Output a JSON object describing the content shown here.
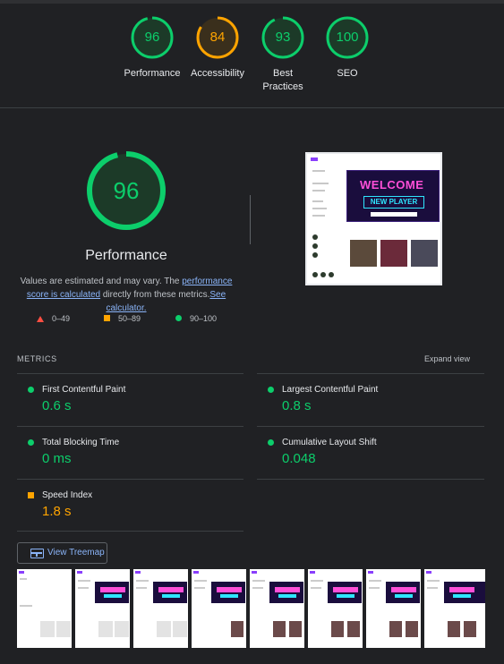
{
  "summary": {
    "gauges": [
      {
        "score": "96",
        "label": "Performance",
        "color": "#0cce6b",
        "fraction": 0.96
      },
      {
        "score": "84",
        "label": "Accessibility",
        "color": "#ffa400",
        "fraction": 0.84
      },
      {
        "score": "93",
        "label": "Best Practices",
        "color": "#0cce6b",
        "fraction": 0.93
      },
      {
        "score": "100",
        "label": "SEO",
        "color": "#0cce6b",
        "fraction": 1.0
      }
    ]
  },
  "performance": {
    "score": "96",
    "fraction": 0.96,
    "title": "Performance",
    "desc_prefix": "Values are estimated and may vary. The ",
    "desc_link1": "performance score is calculated",
    "desc_middle": " directly from these metrics.",
    "desc_link2": "See calculator."
  },
  "screenshot": {
    "banner_line1": "WELCOME",
    "banner_line2": "NEW PLAYER"
  },
  "legend": {
    "fail": "0–49",
    "average": "50–89",
    "pass": "90–100"
  },
  "metrics": {
    "heading": "METRICS",
    "expand": "Expand view",
    "fcp": {
      "name": "First Contentful Paint",
      "value": "0.6 s"
    },
    "lcp": {
      "name": "Largest Contentful Paint",
      "value": "0.8 s"
    },
    "tbt": {
      "name": "Total Blocking Time",
      "value": "0 ms"
    },
    "cls": {
      "name": "Cumulative Layout Shift",
      "value": "0.048"
    },
    "si": {
      "name": "Speed Index",
      "value": "1.8 s"
    }
  },
  "treemap": {
    "label": "View Treemap",
    "icon": "treemap-icon"
  },
  "colors": {
    "pass": "#0cce6b",
    "average": "#ffa400",
    "fail": "#ff4e42",
    "link": "#8ab4f8",
    "background": "#202124"
  }
}
